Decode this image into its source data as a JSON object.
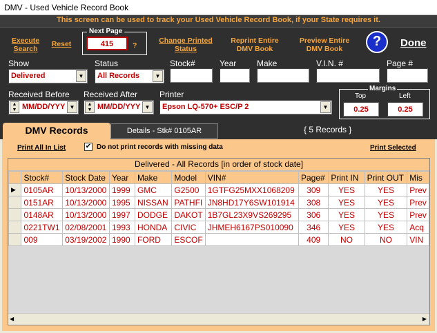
{
  "window": {
    "title": "DMV - Used Vehicle Record Book"
  },
  "banner": "This screen can be used to track your Used Vehicle Record Book, if your State requires it.",
  "toolbar": {
    "execute_search": "Execute Search",
    "reset": "Reset",
    "next_page_label": "Next Page",
    "next_page_value": "415",
    "help_q": "?",
    "change_printed_status": "Change Printed Status",
    "reprint_entire": "Reprint Entire DMV Book",
    "preview_entire": "Preview Entire DMV Book",
    "done": "Done"
  },
  "filters": {
    "show_label": "Show",
    "show_value": "Delivered",
    "status_label": "Status",
    "status_value": "All Records",
    "stock_label": "Stock#",
    "year_label": "Year",
    "make_label": "Make",
    "vin_label": "V.I.N. #",
    "page_label": "Page #",
    "received_before_label": "Received Before",
    "received_before_value": "MM/DD/YYY",
    "received_after_label": "Received After",
    "received_after_value": "MM/DD/YYY",
    "printer_label": "Printer",
    "printer_value": "Epson LQ-570+ ESC/P 2",
    "margins_label": "Margins",
    "top_label": "Top",
    "top_value": "0.25",
    "left_label": "Left",
    "left_value": "0.25"
  },
  "tabs": {
    "dmv_records": "DMV Records",
    "details": "Details - Stk# 0105AR",
    "records_count": "{ 5 Records }"
  },
  "options": {
    "print_all": "Print All In List",
    "no_print_missing": "Do not print records with missing data",
    "print_selected": "Print Selected",
    "no_print_missing_checked": true
  },
  "grid": {
    "caption": "Delivered - All Records [in order of stock date]",
    "columns": [
      "Stock#",
      "Stock Date",
      "Year",
      "Make",
      "Model",
      "VIN#",
      "Page#",
      "Print IN",
      "Print OUT",
      "Mis"
    ],
    "rows": [
      [
        "0105AR",
        "10/13/2000",
        "1999",
        "GMC",
        "G2500",
        "1GTFG25MXX1068209",
        "309",
        "YES",
        "YES",
        "Prev"
      ],
      [
        "0151AR",
        "10/13/2000",
        "1995",
        "NISSAN",
        "PATHFI",
        "JN8HD17Y6SW101914",
        "308",
        "YES",
        "YES",
        "Prev"
      ],
      [
        "0148AR",
        "10/13/2000",
        "1997",
        "DODGE",
        "DAKOT",
        "1B7GL23X9VS269295",
        "306",
        "YES",
        "YES",
        "Prev"
      ],
      [
        "0221TW1",
        "02/08/2001",
        "1993",
        "HONDA",
        "CIVIC",
        "JHMEH6167PS010090",
        "346",
        "YES",
        "YES",
        "Acq"
      ],
      [
        "009",
        "03/19/2002",
        "1990",
        "FORD",
        "ESCOF",
        "",
        "409",
        "NO",
        "NO",
        "VIN"
      ]
    ]
  }
}
